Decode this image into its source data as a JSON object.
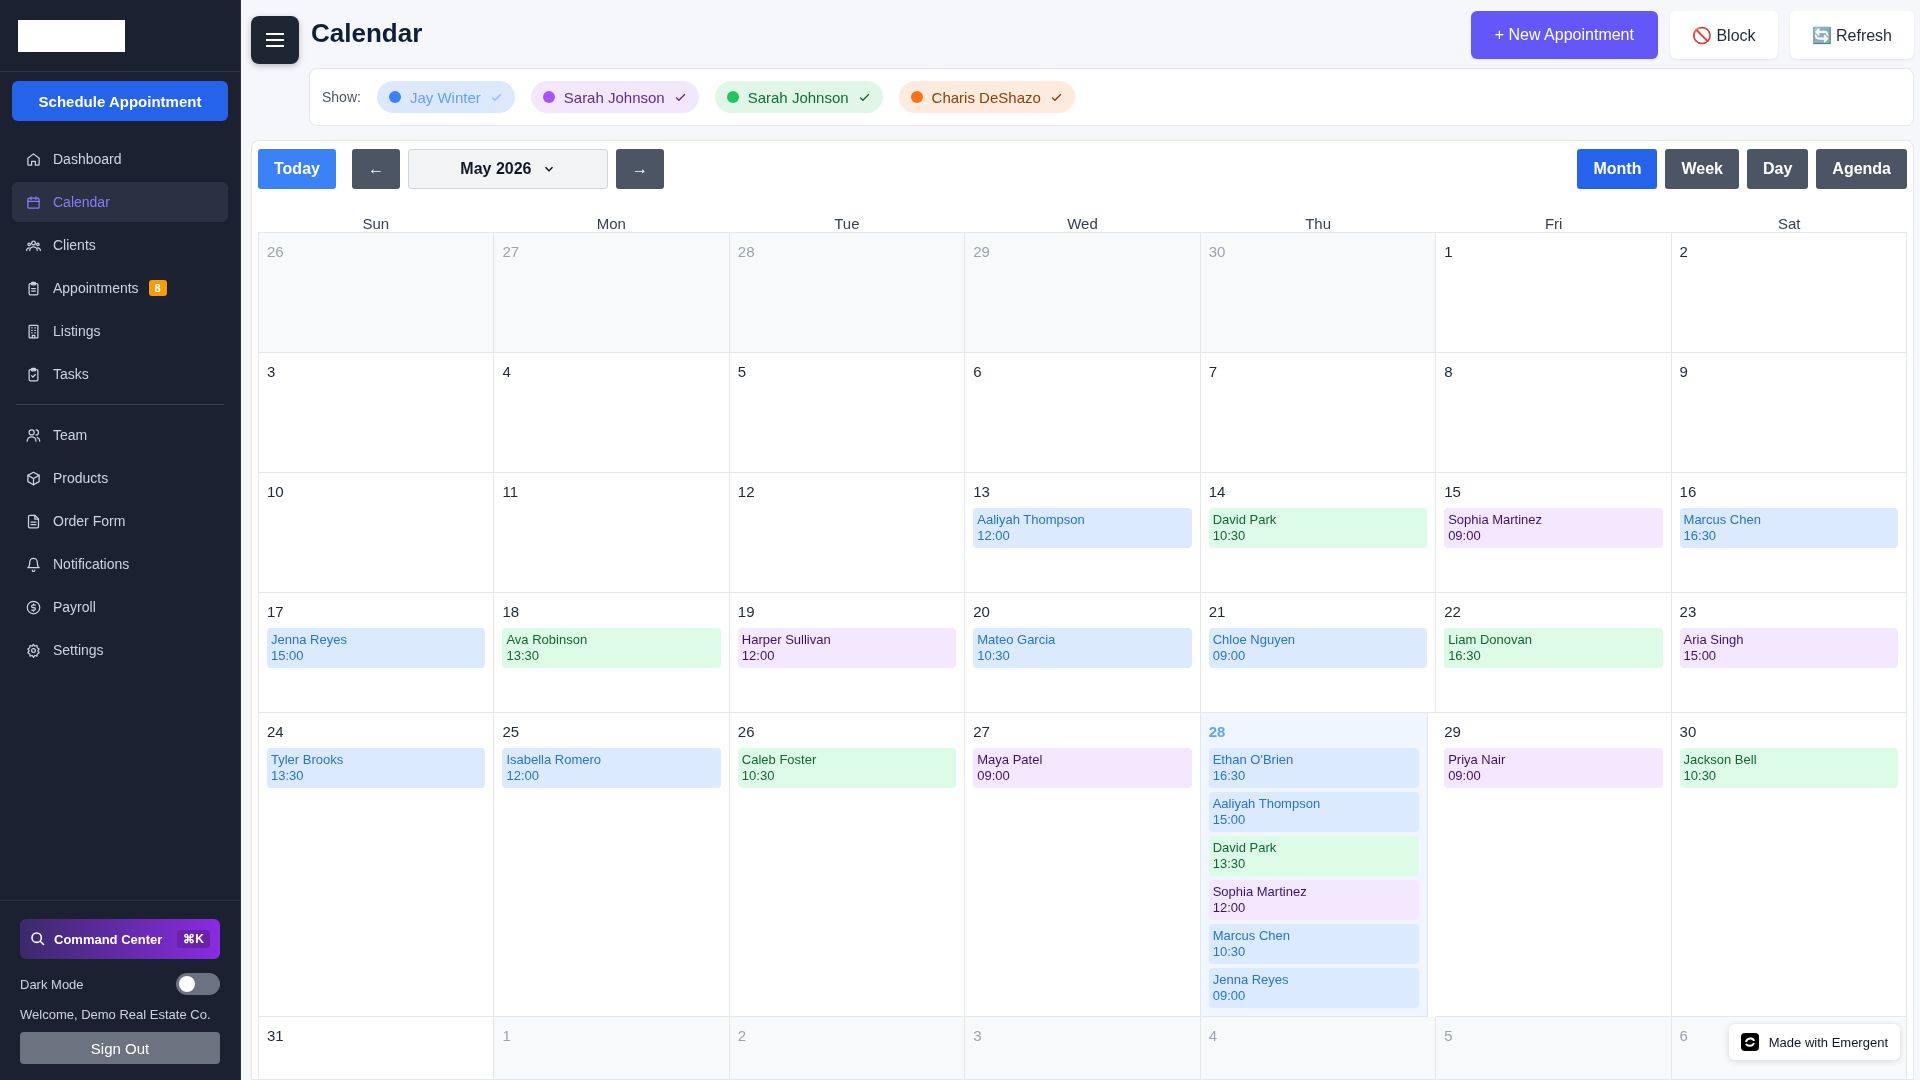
{
  "sidebar": {
    "primary_action": "Schedule Appointment",
    "nav_groups": [
      [
        {
          "label": "Dashboard",
          "selected": false
        },
        {
          "label": "Calendar",
          "selected": true
        },
        {
          "label": "Clients",
          "selected": false
        },
        {
          "label": "Appointments",
          "selected": false,
          "badge": "8"
        },
        {
          "label": "Listings",
          "selected": false
        },
        {
          "label": "Tasks",
          "selected": false
        }
      ],
      [
        {
          "label": "Team",
          "selected": false
        },
        {
          "label": "Products",
          "selected": false
        },
        {
          "label": "Order Form",
          "selected": false
        },
        {
          "label": "Notifications",
          "selected": false
        },
        {
          "label": "Payroll",
          "selected": false
        },
        {
          "label": "Settings",
          "selected": false
        }
      ]
    ],
    "command_center": {
      "label": "Command Center",
      "shortcut": "⌘K"
    },
    "dark_mode": {
      "label": "Dark Mode",
      "on": false
    },
    "welcome": "Welcome, Demo Real Estate Co.",
    "sign_out": "Sign Out"
  },
  "header": {
    "title": "Calendar",
    "buttons": [
      {
        "label": "+ New Appointment",
        "kind": "primary"
      },
      {
        "label": "🚫 Block",
        "kind": "plain"
      },
      {
        "label": "🔄 Refresh",
        "kind": "plain"
      }
    ]
  },
  "filters": {
    "label": "Show:",
    "items": [
      {
        "label": "Jay Winter",
        "color": "#3b82f6",
        "selected": false
      },
      {
        "label": "Sarah Johnson",
        "color": "#a855f7",
        "selected": true
      },
      {
        "label": "Sarah Johnson",
        "color": "#22c55e",
        "selected": true
      },
      {
        "label": "Charis DeShazo",
        "color": "#f97316",
        "selected": true
      }
    ]
  },
  "toolbar": {
    "today": "Today",
    "prev": "←",
    "month": "May 2026",
    "next": "→",
    "views": [
      {
        "label": "Month",
        "selected": true
      },
      {
        "label": "Week",
        "selected": false
      },
      {
        "label": "Day",
        "selected": false
      },
      {
        "label": "Agenda",
        "selected": false
      }
    ]
  },
  "weekdays": [
    "Sun",
    "Mon",
    "Tue",
    "Wed",
    "Thu",
    "Fri",
    "Sat"
  ],
  "weeks": [
    [
      {
        "day": "26",
        "faded": true,
        "today": false
      },
      {
        "day": "27",
        "faded": true,
        "today": false
      },
      {
        "day": "28",
        "faded": true,
        "today": false
      },
      {
        "day": "29",
        "faded": true,
        "today": false
      },
      {
        "day": "30",
        "faded": true,
        "today": false
      },
      {
        "day": "1",
        "faded": false,
        "today": false
      },
      {
        "day": "2",
        "faded": false,
        "today": false
      }
    ],
    [
      {
        "day": "3",
        "faded": false,
        "today": false
      },
      {
        "day": "4",
        "faded": false,
        "today": false
      },
      {
        "day": "5",
        "faded": false,
        "today": false
      },
      {
        "day": "6",
        "faded": false,
        "today": false
      },
      {
        "day": "7",
        "faded": false,
        "today": false
      },
      {
        "day": "8",
        "faded": false,
        "today": false
      },
      {
        "day": "9",
        "faded": false,
        "today": false
      }
    ],
    [
      {
        "day": "10",
        "faded": false,
        "today": false
      },
      {
        "day": "11",
        "faded": false,
        "today": false
      },
      {
        "day": "12",
        "faded": false,
        "today": false
      },
      {
        "day": "13",
        "faded": false,
        "today": false,
        "events": [
          {
            "name": "Aaliyah Thompson",
            "time": "12:00",
            "color": "#dbeafe",
            "dimmed": true
          }
        ]
      },
      {
        "day": "14",
        "faded": false,
        "today": false,
        "events": [
          {
            "name": "David Park",
            "time": "10:30",
            "color": "#dcfce7",
            "dimmed": false
          }
        ]
      },
      {
        "day": "15",
        "faded": false,
        "today": false,
        "events": [
          {
            "name": "Sophia Martinez",
            "time": "09:00",
            "color": "#f3e8ff",
            "dimmed": false
          }
        ]
      },
      {
        "day": "16",
        "faded": false,
        "today": false,
        "events": [
          {
            "name": "Marcus Chen",
            "time": "16:30",
            "color": "#dbeafe",
            "dimmed": true
          }
        ]
      }
    ],
    [
      {
        "day": "17",
        "faded": false,
        "today": false,
        "events": [
          {
            "name": "Jenna Reyes",
            "time": "15:00",
            "color": "#dbeafe",
            "dimmed": true
          }
        ]
      },
      {
        "day": "18",
        "faded": false,
        "today": false,
        "events": [
          {
            "name": "Ava Robinson",
            "time": "13:30",
            "color": "#dcfce7",
            "dimmed": false
          }
        ]
      },
      {
        "day": "19",
        "faded": false,
        "today": false,
        "events": [
          {
            "name": "Harper Sullivan",
            "time": "12:00",
            "color": "#f3e8ff",
            "dimmed": false
          }
        ]
      },
      {
        "day": "20",
        "faded": false,
        "today": false,
        "events": [
          {
            "name": "Mateo Garcia",
            "time": "10:30",
            "color": "#dbeafe",
            "dimmed": true
          }
        ]
      },
      {
        "day": "21",
        "faded": false,
        "today": false,
        "events": [
          {
            "name": "Chloe Nguyen",
            "time": "09:00",
            "color": "#dbeafe",
            "dimmed": true
          }
        ]
      },
      {
        "day": "22",
        "faded": false,
        "today": false,
        "events": [
          {
            "name": "Liam Donovan",
            "time": "16:30",
            "color": "#dcfce7",
            "dimmed": false
          }
        ]
      },
      {
        "day": "23",
        "faded": false,
        "today": false,
        "events": [
          {
            "name": "Aria Singh",
            "time": "15:00",
            "color": "#f3e8ff",
            "dimmed": false
          }
        ]
      }
    ],
    [
      {
        "day": "24",
        "faded": false,
        "today": false,
        "events": [
          {
            "name": "Tyler Brooks",
            "time": "13:30",
            "color": "#dbeafe",
            "dimmed": true
          }
        ]
      },
      {
        "day": "25",
        "faded": false,
        "today": false,
        "events": [
          {
            "name": "Isabella Romero",
            "time": "12:00",
            "color": "#dbeafe",
            "dimmed": true
          }
        ]
      },
      {
        "day": "26",
        "faded": false,
        "today": false,
        "events": [
          {
            "name": "Caleb Foster",
            "time": "10:30",
            "color": "#dcfce7",
            "dimmed": false
          }
        ]
      },
      {
        "day": "27",
        "faded": false,
        "today": false,
        "events": [
          {
            "name": "Maya Patel",
            "time": "09:00",
            "color": "#f3e8ff",
            "dimmed": false
          }
        ]
      },
      {
        "day": "28",
        "faded": false,
        "today": true,
        "events": [
          {
            "name": "Ethan O'Brien",
            "time": "16:30",
            "color": "#dbeafe",
            "dimmed": true
          },
          {
            "name": "Aaliyah Thompson",
            "time": "15:00",
            "color": "#dbeafe",
            "dimmed": true
          },
          {
            "name": "David Park",
            "time": "13:30",
            "color": "#dcfce7",
            "dimmed": false
          },
          {
            "name": "Sophia Martinez",
            "time": "12:00",
            "color": "#f3e8ff",
            "dimmed": false
          },
          {
            "name": "Marcus Chen",
            "time": "10:30",
            "color": "#dbeafe",
            "dimmed": true
          },
          {
            "name": "Jenna Reyes",
            "time": "09:00",
            "color": "#dbeafe",
            "dimmed": true
          }
        ]
      },
      {
        "day": "29",
        "faded": false,
        "today": false,
        "events": [
          {
            "name": "Priya Nair",
            "time": "09:00",
            "color": "#f3e8ff",
            "dimmed": false
          }
        ]
      },
      {
        "day": "30",
        "faded": false,
        "today": false,
        "events": [
          {
            "name": "Jackson Bell",
            "time": "10:30",
            "color": "#dcfce7",
            "dimmed": false
          }
        ]
      }
    ],
    [
      {
        "day": "31",
        "faded": false,
        "today": false
      },
      {
        "day": "1",
        "faded": true,
        "today": false
      },
      {
        "day": "2",
        "faded": true,
        "today": false
      },
      {
        "day": "3",
        "faded": true,
        "today": false
      },
      {
        "day": "4",
        "faded": true,
        "today": false
      },
      {
        "day": "5",
        "faded": true,
        "today": false
      },
      {
        "day": "6",
        "faded": true,
        "today": false
      }
    ]
  ],
  "floating_badge": "Made with Emergent"
}
